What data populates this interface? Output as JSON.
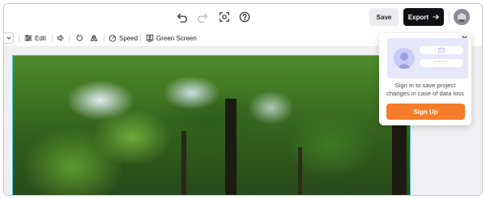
{
  "topbar": {
    "icons": [
      "undo-icon",
      "redo-icon",
      "screen-capture-icon",
      "help-icon"
    ],
    "save_label": "Save",
    "export_label": "Export"
  },
  "toolbar": {
    "items": [
      {
        "icon": "sliders-icon",
        "label": "Edit"
      },
      {
        "icon": "volume-icon",
        "label": ""
      },
      {
        "icon": "rotate-icon",
        "label": ""
      },
      {
        "icon": "flip-icon",
        "label": ""
      },
      {
        "icon": "speedometer-icon",
        "label": "Speed"
      },
      {
        "icon": "green-screen-icon",
        "label": "Green Screen"
      }
    ]
  },
  "popover": {
    "password_mask": "******",
    "message": "Sign in to save project changes in case of data loss",
    "signup_label": "Sign Up"
  },
  "colors": {
    "accent_orange": "#f57c2a",
    "export_bg": "#111114",
    "selection_cyan": "#3ec8dd",
    "illustration_bg": "#e6e7fb"
  }
}
